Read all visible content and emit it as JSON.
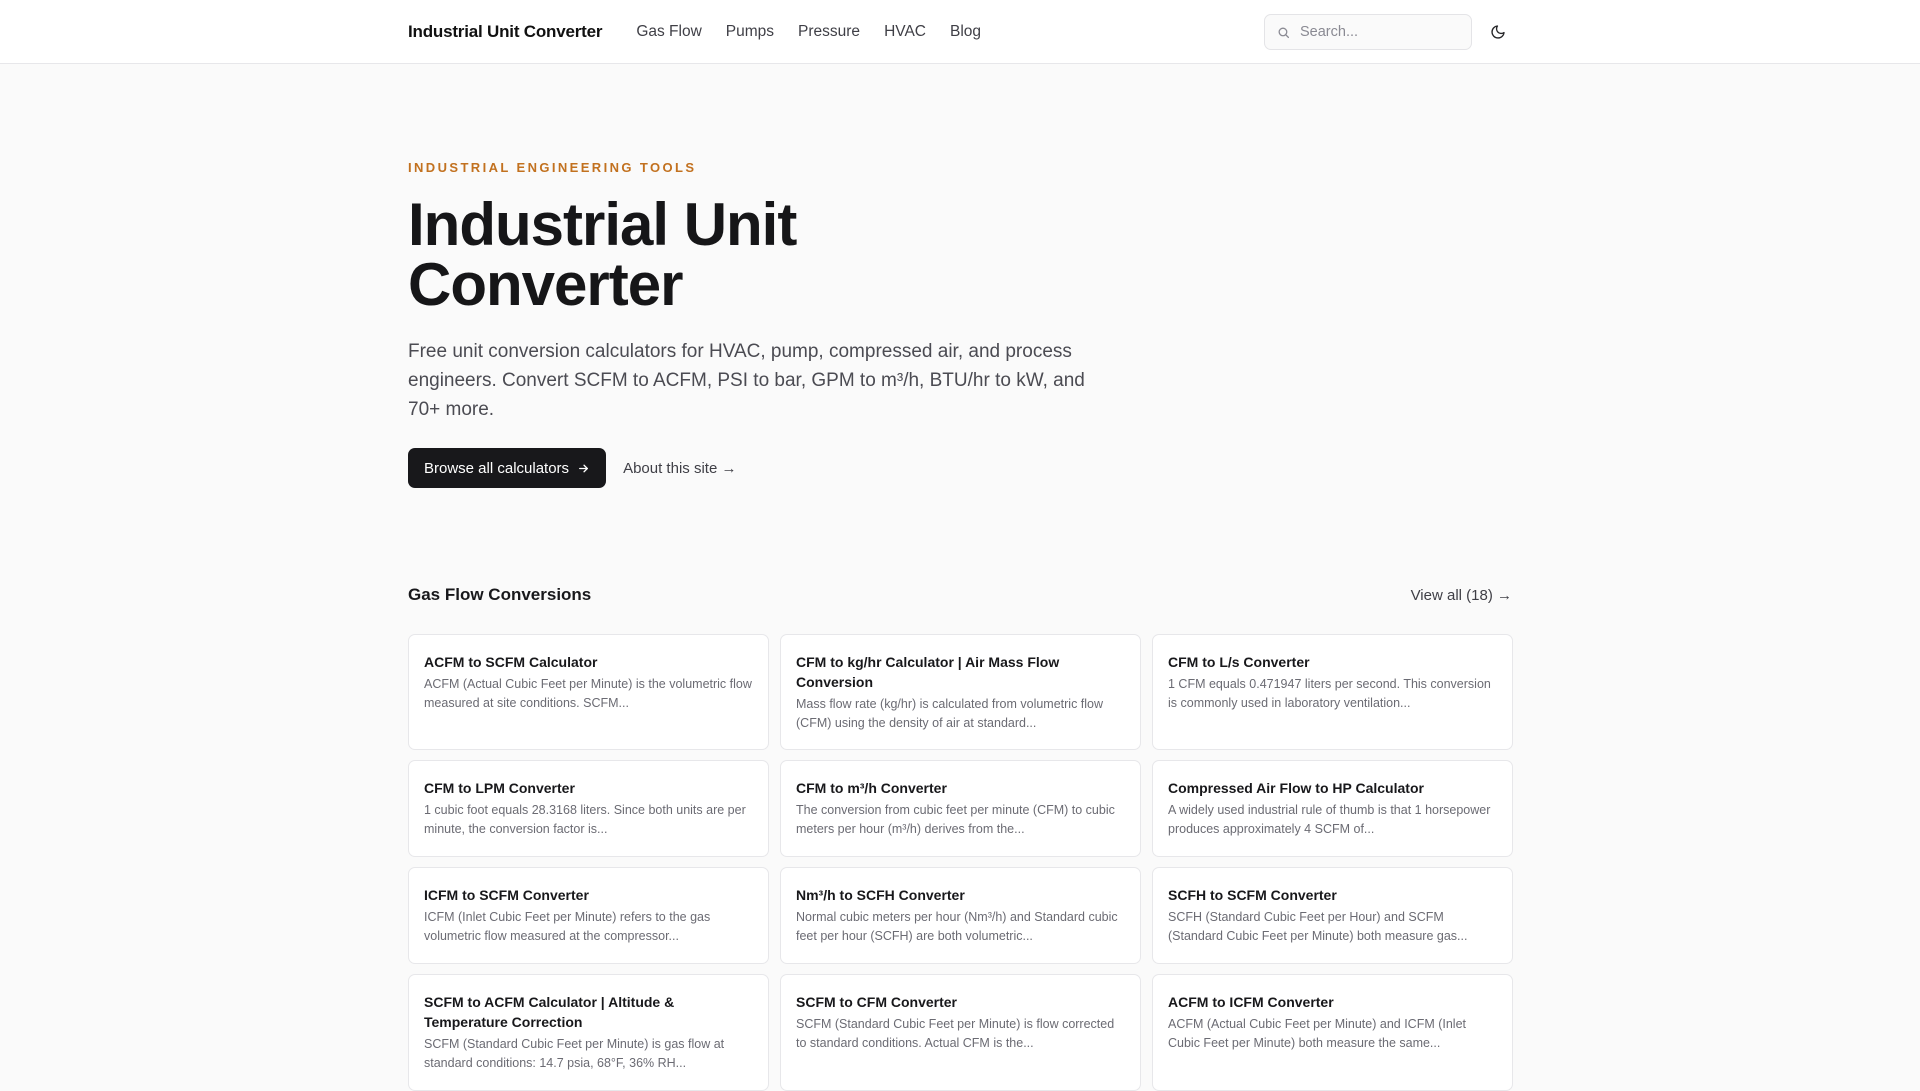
{
  "header": {
    "brand": "Industrial Unit Converter",
    "nav": [
      "Gas Flow",
      "Pumps",
      "Pressure",
      "HVAC",
      "Blog"
    ],
    "search_placeholder": "Search...",
    "icons": {
      "search": "search-icon",
      "theme": "moon-icon"
    }
  },
  "hero": {
    "eyebrow": "INDUSTRIAL ENGINEERING TOOLS",
    "title": "Industrial Unit Converter",
    "description": "Free unit conversion calculators for HVAC, pump, compressed air, and process engineers. Convert SCFM to ACFM, PSI to bar, GPM to m³/h, BTU/hr to kW, and 70+ more.",
    "primary_button": "Browse all calculators",
    "secondary_link": "About this site →"
  },
  "gas_flow": {
    "title": "Gas Flow Conversions",
    "view_all": "View all (18) →",
    "cards": [
      {
        "title": "ACFM to SCFM Calculator",
        "desc": "ACFM (Actual Cubic Feet per Minute) is the volumetric flow measured at site conditions. SCFM..."
      },
      {
        "title": "CFM to kg/hr Calculator | Air Mass Flow Conversion",
        "desc": "Mass flow rate (kg/hr) is calculated from volumetric flow (CFM) using the density of air at standard..."
      },
      {
        "title": "CFM to L/s Converter",
        "desc": "1 CFM equals 0.471947 liters per second. This conversion is commonly used in laboratory ventilation..."
      },
      {
        "title": "CFM to LPM Converter",
        "desc": "1 cubic foot equals 28.3168 liters. Since both units are per minute, the conversion factor is..."
      },
      {
        "title": "CFM to m³/h Converter",
        "desc": "The conversion from cubic feet per minute (CFM) to cubic meters per hour (m³/h) derives from the..."
      },
      {
        "title": "Compressed Air Flow to HP Calculator",
        "desc": "A widely used industrial rule of thumb is that 1 horsepower produces approximately 4 SCFM of..."
      },
      {
        "title": "ICFM to SCFM Converter",
        "desc": "ICFM (Inlet Cubic Feet per Minute) refers to the gas volumetric flow measured at the compressor..."
      },
      {
        "title": "Nm³/h to SCFH Converter",
        "desc": "Normal cubic meters per hour (Nm³/h) and Standard cubic feet per hour (SCFH) are both volumetric..."
      },
      {
        "title": "SCFH to SCFM Converter",
        "desc": "SCFH (Standard Cubic Feet per Hour) and SCFM (Standard Cubic Feet per Minute) both measure gas..."
      },
      {
        "title": "SCFM to ACFM Calculator | Altitude & Temperature Correction",
        "desc": "SCFM (Standard Cubic Feet per Minute) is gas flow at standard conditions: 14.7 psia, 68°F, 36% RH..."
      },
      {
        "title": "SCFM to CFM Converter",
        "desc": "SCFM (Standard Cubic Feet per Minute) is flow corrected to standard conditions. Actual CFM is the..."
      },
      {
        "title": "ACFM to ICFM Converter",
        "desc": "ACFM (Actual Cubic Feet per Minute) and ICFM (Inlet Cubic Feet per Minute) both measure the same..."
      }
    ]
  }
}
